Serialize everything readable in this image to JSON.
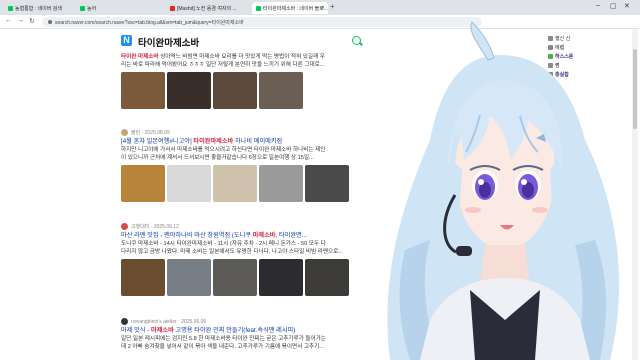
{
  "browser": {
    "tabs": [
      {
        "label": "농협통합 : 네이버 검색",
        "color": "#03c75a",
        "active": false
      },
      {
        "label": "농어",
        "color": "#03c75a",
        "active": false
      },
      {
        "label": "[Mashd] 노컨 용경 여자의 ...",
        "color": "#e5281f",
        "active": false
      },
      {
        "label": "타이완마제소바 : 네이버 블로...",
        "color": "#03c75a",
        "active": true
      }
    ],
    "url": "search.naver.com/search.naver?ssc=tab.blog.all&sm=tab_jum&query=타이완마제소바"
  },
  "naver": {
    "logo": "N",
    "query": "타이완마제소바"
  },
  "results": [
    {
      "title_pre": "",
      "title_hl": "",
      "title_post": "",
      "snippet1_hl": "타이완 마제소바",
      "snippet1": " 성아역느 비빔면 마제소바 요리를 더 맛있게 먹는 병법이 적혀 있길래 우",
      "snippet2": "리는 바로 따라해 먹어봤어요 ㅎㅎㅎ 일단 저렇게 분연히 맛을 느끼기 위해 다른 그대로...",
      "thumb_colors": [
        "#7a5a3a",
        "#3a2e2a",
        "#5b4a3c",
        "#6b5f55"
      ]
    },
    {
      "author": "불린 · 2025.08.09",
      "title_pre": "[4월 혼자 일본여행#니고야] ",
      "title_hl": "타이완마제소바",
      "title_post": " 하나비 메이에키점",
      "snippet1": "하지만 니고야에 가서서 마제소바를 먹으시려고 하신다면 타이완 마제소바 하나비는 제인",
      "snippet2": "이 있으니까 근처에 계셔서 드셔보시면 좋을거같습니다 6장으로 일본여행 상 15일...",
      "thumb_colors": [
        "#b8843a",
        "#d9d9d9",
        "#cfc2ad",
        "#9a9a9a",
        "#4a4a4a"
      ]
    },
    {
      "author": "고행대미 · 2025.09.12",
      "title_pre": "마산 라멘 맛집 - 멘야하나비 마산 창원역점 (도니쿠 ",
      "title_hl": "마제소바",
      "title_post": ", 타이완면...",
      "snippet1": "도니쿠 마제소바 - 14시 타이완마제소바 - 11시 (자유 주차 - 2시 메니 돈가스 - 50 모두 다",
      "snippet2": "다리지 않고 금방 나왔다. 마제 소바는 일본에서도 유명한 디너다, 나고야 스타일 비빔 라멘으로...",
      "thumb_colors": [
        "#6a4c2e",
        "#777e86",
        "#5c5b58",
        "#2b2b30",
        "#3d3b38"
      ]
    },
    {
      "author": "noriangbinin's atelier · 2025.06.06",
      "title_pre": "마제 맛식 - ",
      "title_hl": "마제소바",
      "title_post": " 고명용 타이완 민찌 만들기(feat.속식맨 레시피)",
      "snippet1": "일단 일본 레시피에는 검지민 5.8 한 마제소바용 타이완 민찌는 굳은 고추가루가 들어가는",
      "snippet2": "데 2 아빠 숨겨찾을 넣어서 같이 볶아 색을 내준다. 고추가루가 기름에 볶이면서 고추기..."
    }
  ],
  "chat": [
    {
      "nick": "",
      "msg": "행신 신"
    },
    {
      "nick": "",
      "msg": "에렙"
    },
    {
      "nick": "하스스톤",
      "msg": ""
    },
    {
      "nick": "",
      "msg": "쩜"
    },
    {
      "nick": "충실함",
      "msg": ""
    }
  ],
  "colors": {
    "naver_green": "#03c75a",
    "link_blue": "#0d3ba8",
    "highlight_red": "#d6223d",
    "hair_light": "#cfe4f5",
    "hair_shade": "#8fb6dc",
    "eye_purple": "#7b5ad6"
  }
}
